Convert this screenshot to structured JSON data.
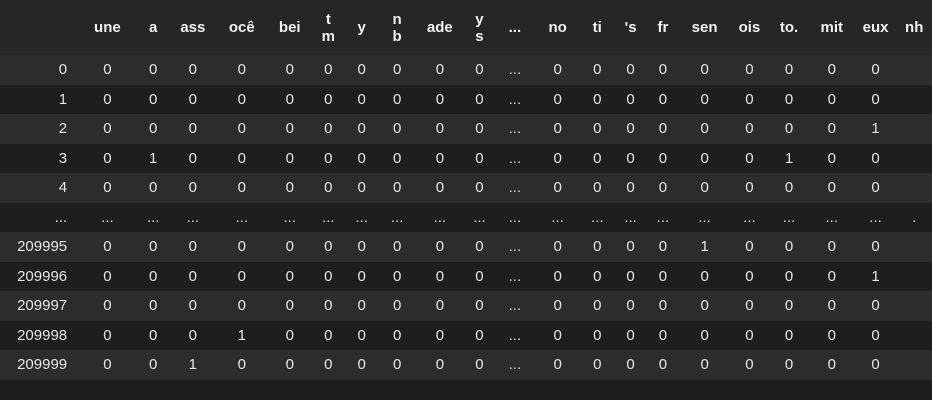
{
  "dataframe": {
    "columns": [
      "une",
      "a",
      "ass",
      "ocê",
      "bei",
      "t\nm",
      "y",
      "n\nb",
      "ade",
      "y\ns",
      "...",
      "no",
      "ti",
      "'s",
      "fr",
      "sen",
      "ois",
      "to.",
      "mit",
      "eux",
      "nh"
    ],
    "rows": [
      {
        "index": "0",
        "cells": [
          "0",
          "0",
          "0",
          "0",
          "0",
          "0",
          "0",
          "0",
          "0",
          "0",
          "...",
          "0",
          "0",
          "0",
          "0",
          "0",
          "0",
          "0",
          "0",
          "0",
          ""
        ]
      },
      {
        "index": "1",
        "cells": [
          "0",
          "0",
          "0",
          "0",
          "0",
          "0",
          "0",
          "0",
          "0",
          "0",
          "...",
          "0",
          "0",
          "0",
          "0",
          "0",
          "0",
          "0",
          "0",
          "0",
          ""
        ]
      },
      {
        "index": "2",
        "cells": [
          "0",
          "0",
          "0",
          "0",
          "0",
          "0",
          "0",
          "0",
          "0",
          "0",
          "...",
          "0",
          "0",
          "0",
          "0",
          "0",
          "0",
          "0",
          "0",
          "1",
          ""
        ]
      },
      {
        "index": "3",
        "cells": [
          "0",
          "1",
          "0",
          "0",
          "0",
          "0",
          "0",
          "0",
          "0",
          "0",
          "...",
          "0",
          "0",
          "0",
          "0",
          "0",
          "0",
          "1",
          "0",
          "0",
          ""
        ]
      },
      {
        "index": "4",
        "cells": [
          "0",
          "0",
          "0",
          "0",
          "0",
          "0",
          "0",
          "0",
          "0",
          "0",
          "...",
          "0",
          "0",
          "0",
          "0",
          "0",
          "0",
          "0",
          "0",
          "0",
          ""
        ]
      },
      {
        "index": "...",
        "cells": [
          "...",
          "...",
          "...",
          "...",
          "...",
          "...",
          "...",
          "...",
          "...",
          "...",
          "...",
          "...",
          "...",
          "...",
          "...",
          "...",
          "...",
          "...",
          "...",
          "...",
          "."
        ]
      },
      {
        "index": "209995",
        "cells": [
          "0",
          "0",
          "0",
          "0",
          "0",
          "0",
          "0",
          "0",
          "0",
          "0",
          "...",
          "0",
          "0",
          "0",
          "0",
          "1",
          "0",
          "0",
          "0",
          "0",
          ""
        ]
      },
      {
        "index": "209996",
        "cells": [
          "0",
          "0",
          "0",
          "0",
          "0",
          "0",
          "0",
          "0",
          "0",
          "0",
          "...",
          "0",
          "0",
          "0",
          "0",
          "0",
          "0",
          "0",
          "0",
          "1",
          ""
        ]
      },
      {
        "index": "209997",
        "cells": [
          "0",
          "0",
          "0",
          "0",
          "0",
          "0",
          "0",
          "0",
          "0",
          "0",
          "...",
          "0",
          "0",
          "0",
          "0",
          "0",
          "0",
          "0",
          "0",
          "0",
          ""
        ]
      },
      {
        "index": "209998",
        "cells": [
          "0",
          "0",
          "0",
          "1",
          "0",
          "0",
          "0",
          "0",
          "0",
          "0",
          "...",
          "0",
          "0",
          "0",
          "0",
          "0",
          "0",
          "0",
          "0",
          "0",
          ""
        ]
      },
      {
        "index": "209999",
        "cells": [
          "0",
          "0",
          "1",
          "0",
          "0",
          "0",
          "0",
          "0",
          "0",
          "0",
          "...",
          "0",
          "0",
          "0",
          "0",
          "0",
          "0",
          "0",
          "0",
          "0",
          ""
        ]
      }
    ]
  },
  "colors": {
    "background": "#1e1e1e",
    "row_stripe": "#2c2c2c",
    "header_bg": "#262626",
    "text": "#e6e6e6"
  }
}
